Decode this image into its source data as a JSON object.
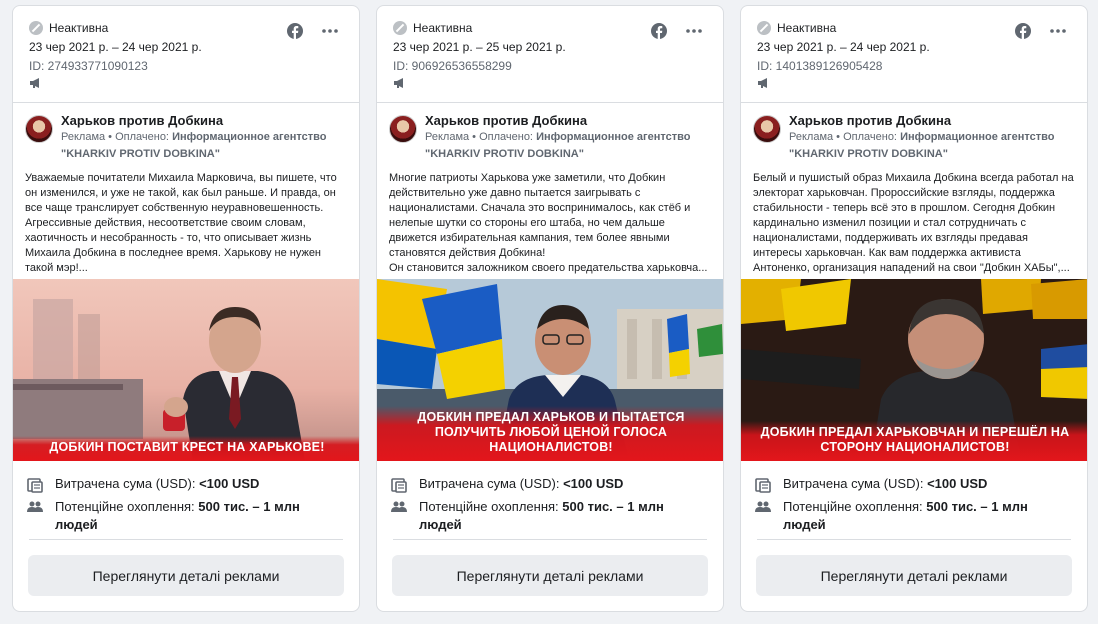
{
  "cards": [
    {
      "status": "Неактивна",
      "dates": "23 чер 2021 р. – 24 чер 2021 р.",
      "ad_id": "ID: 274933771090123",
      "page_name": "Харьков против Добкина",
      "sponsor_prefix": "Реклама • Оплачено: ",
      "sponsor_name": "Информационное агентство \"KHARKIV PROTIV DOBKINA\"",
      "body": "Уважаемые почитатели Михаила Марковича, вы пишете, что он изменился, и уже не такой, как был раньше. И правда, он все чаще транслирует собственную неуравновешенность. Агрессивные действия, несоответствие своим словам, хаотичность и несобранность - то, что описывает жизнь Михаила Добкина в последнее время. Харькову не нужен такой мэр!...",
      "banner": "Добкин поставит крест на Харькове!",
      "spend_label": "Витрачена сума (USD): ",
      "spend_value": "<100 USD",
      "reach_label": "Потенційне охоплення: ",
      "reach_value": "500 тис. – 1 млн людей",
      "button": "Переглянути деталі реклами"
    },
    {
      "status": "Неактивна",
      "dates": "23 чер 2021 р. – 25 чер 2021 р.",
      "ad_id": "ID: 906926536558299",
      "page_name": "Харьков против Добкина",
      "sponsor_prefix": "Реклама • Оплачено: ",
      "sponsor_name": "Информационное агентство \"KHARKIV PROTIV DOBKINA\"",
      "body": "Многие патриоты Харькова уже заметили, что Добкин действительно уже давно пытается заигрывать с националистами. Сначала это воспринималось, как стёб и нелепые шутки со стороны его штаба, но чем дальше движется избирательная кампания, тем более явными становятся действия Добкина!\nОн становится заложником своего предательства харьковча...",
      "banner": "Добкин предал Харьков и пытается получить любой ценой голоса националистов!",
      "spend_label": "Витрачена сума (USD): ",
      "spend_value": "<100 USD",
      "reach_label": "Потенційне охоплення: ",
      "reach_value": "500 тис. – 1 млн людей",
      "button": "Переглянути деталі реклами"
    },
    {
      "status": "Неактивна",
      "dates": "23 чер 2021 р. – 24 чер 2021 р.",
      "ad_id": "ID: 1401389126905428",
      "page_name": "Харьков против Добкина",
      "sponsor_prefix": "Реклама • Оплачено: ",
      "sponsor_name": "Информационное агентство \"KHARKIV PROTIV DOBKINA\"",
      "body": "Белый и пушистый образ Михаила Добкина всегда работал на электорат харьковчан. Пророссийские взгляды, поддержка стабильности - теперь всё это в прошлом. Сегодня Добкин кардинально изменил позиции и стал сотрудничать с националистами, поддерживать их взгляды предавая интересы харьковчан. Как вам поддержка активиста Антоненко, организация нападений на свои \"Добкин ХАБы\",...",
      "banner": "Добкин предал харьковчан и перешёл на сторону националистов!",
      "spend_label": "Витрачена сума (USD): ",
      "spend_value": "<100 USD",
      "reach_label": "Потенційне охоплення: ",
      "reach_value": "500 тис. – 1 млн людей",
      "button": "Переглянути деталі реклами"
    }
  ],
  "icons": {
    "status": "inactive-status-icon",
    "platform": "facebook-icon",
    "more": "more-options-icon",
    "placement": "megaphone-icon",
    "spend": "money-icon",
    "reach": "people-icon"
  },
  "colors": {
    "facebook": "#1877f2",
    "banner_red": "#e3161b",
    "button_bg": "#ebedf0"
  }
}
